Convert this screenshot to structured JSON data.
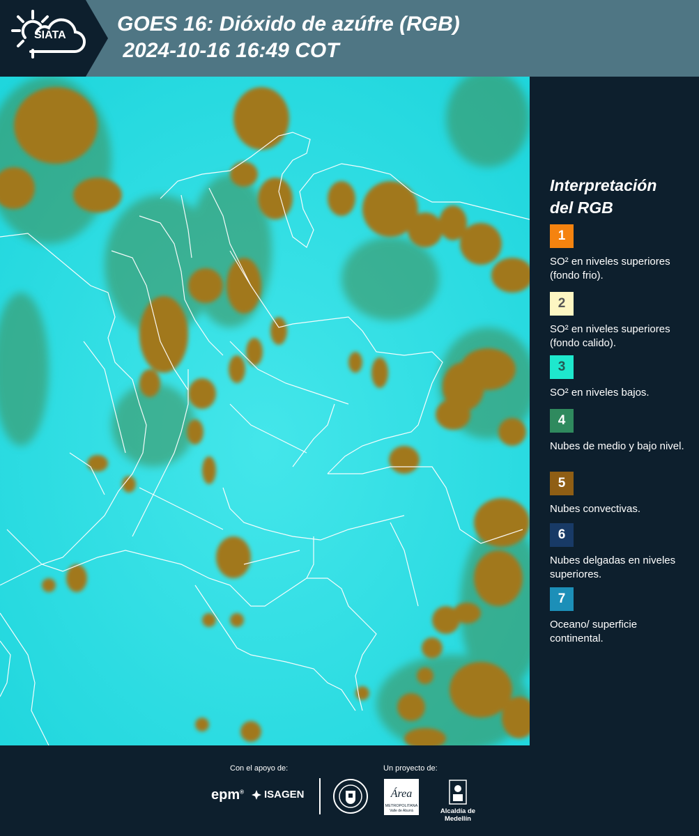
{
  "header": {
    "logo_text": "SIATA",
    "title_line1": "GOES 16: Dióxido de azúfre (RGB)",
    "title_line2": " 2024-10-16 16:49 COT"
  },
  "legend": {
    "title_line1": "Interpretación",
    "title_line2": "del RGB",
    "items": [
      {
        "number": "1",
        "color": "#f5830f",
        "text_color": "#ffffff",
        "label": "SO² en niveles superiores (fondo frio)."
      },
      {
        "number": "2",
        "color": "#fdf6c2",
        "text_color": "#555555",
        "label": "SO² en niveles superiores (fondo calido)."
      },
      {
        "number": "3",
        "color": "#1ee8cd",
        "text_color": "#245a55",
        "label": "SO² en niveles bajos."
      },
      {
        "number": "4",
        "color": "#2f8a5e",
        "text_color": "#ffffff",
        "label": "Nubes de medio y bajo nivel."
      },
      {
        "number": "5",
        "color": "#8f5e14",
        "text_color": "#ffffff",
        "label": "Nubes convectivas."
      },
      {
        "number": "6",
        "color": "#183a66",
        "text_color": "#ffffff",
        "label": "Nubes delgadas en niveles superiores."
      },
      {
        "number": "7",
        "color": "#1c8fb8",
        "text_color": "#ffffff",
        "label": "Oceano/ superficie continental."
      }
    ]
  },
  "map_colors": {
    "background": "#27dce3",
    "convective": "#a1781f",
    "mid_low": "#3f8c52"
  },
  "footer": {
    "support_label": "Con el apoyo de:",
    "project_label": "Un proyecto de:",
    "epm": "epm",
    "isagen": "ISAGEN",
    "area_text": "Área",
    "area_sub1": "METROPOLITANA",
    "area_sub2": "Valle de Aburrá",
    "alcaldia": "Alcaldía de Medellín"
  }
}
